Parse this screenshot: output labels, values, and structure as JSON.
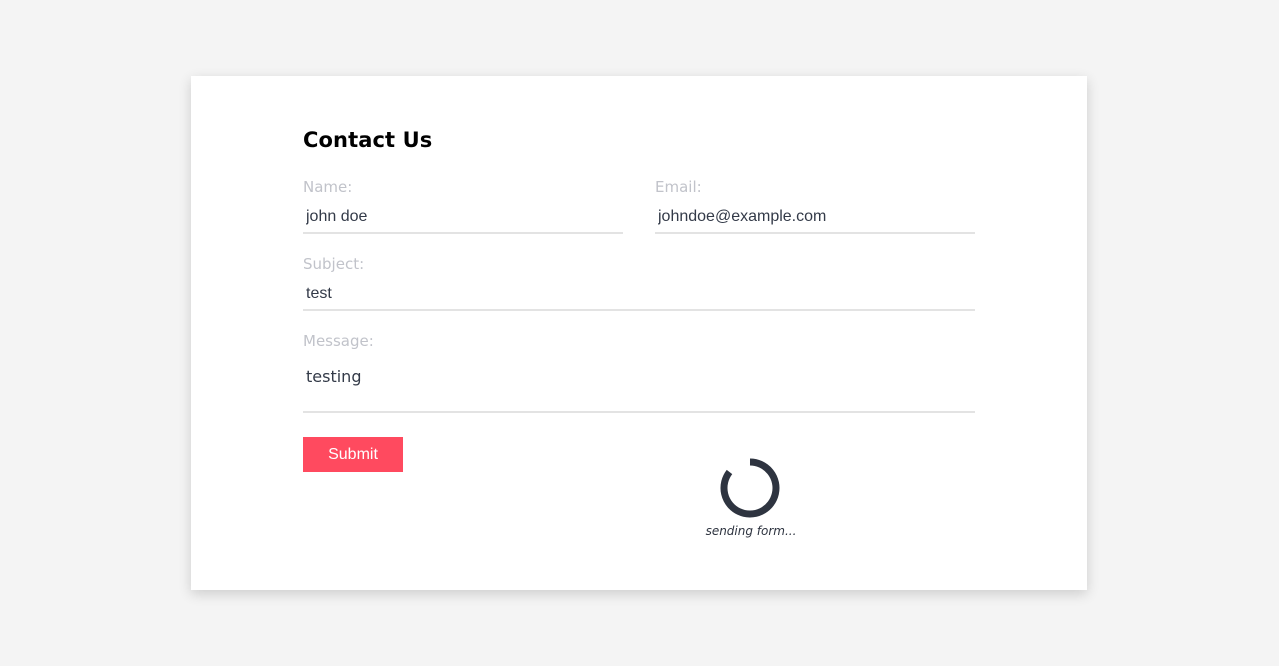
{
  "form": {
    "title": "Contact Us",
    "name": {
      "label": "Name:",
      "value": "john doe"
    },
    "email": {
      "label": "Email:",
      "value": "johndoe@example.com"
    },
    "subject": {
      "label": "Subject:",
      "value": "test"
    },
    "message": {
      "label": "Message:",
      "value": "testing"
    },
    "submit_label": "Submit"
  },
  "status": {
    "loading_text": "sending form..."
  },
  "colors": {
    "accent": "#ff4a5f",
    "label": "#c1c3ca",
    "text": "#333a48",
    "spinner": "#2e3440",
    "background": "#f4f4f4"
  },
  "icons": {
    "spinner": "loading-spinner-icon"
  }
}
